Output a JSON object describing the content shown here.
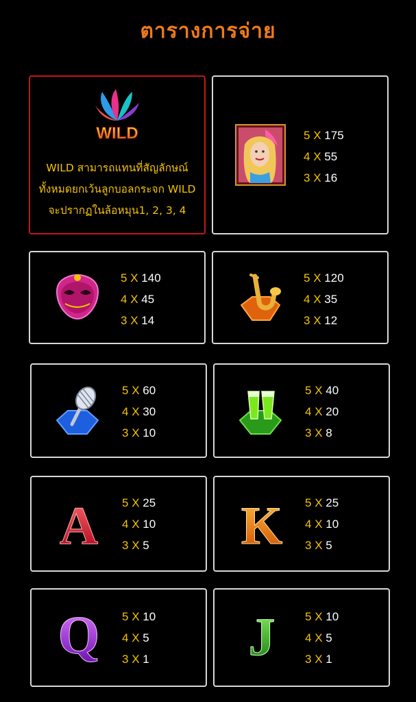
{
  "title": "ตารางการจ่าย",
  "wild": {
    "description": "WILD สามารถแทนที่สัญลักษณ์ทั้งหมดยกเว้นลูกบอลกระจก WILD จะปรากฏในล้อหมุน1, 2, 3, 4",
    "line1": "WILD สามารถแทนที่สัญลักษณ์",
    "line2": "ทั้งหมดยกเว้นลูกบอลกระจก WILD",
    "line3": "จะปรากฏในล้อหมุน1, 2, 3, 4",
    "logo_text": "WILD",
    "icon": "wild-feather-icon"
  },
  "symbols": [
    {
      "id": "woman",
      "icon": "carnival-woman-icon",
      "pays": [
        {
          "count": "5",
          "x": "X",
          "value": "175"
        },
        {
          "count": "4",
          "x": "X",
          "value": "55"
        },
        {
          "count": "3",
          "x": "X",
          "value": "16"
        }
      ]
    },
    {
      "id": "mask",
      "icon": "carnival-mask-icon",
      "pays": [
        {
          "count": "5",
          "x": "X",
          "value": "140"
        },
        {
          "count": "4",
          "x": "X",
          "value": "45"
        },
        {
          "count": "3",
          "x": "X",
          "value": "14"
        }
      ]
    },
    {
      "id": "saxophone",
      "icon": "saxophone-icon",
      "pays": [
        {
          "count": "5",
          "x": "X",
          "value": "120"
        },
        {
          "count": "4",
          "x": "X",
          "value": "35"
        },
        {
          "count": "3",
          "x": "X",
          "value": "12"
        }
      ]
    },
    {
      "id": "microphone",
      "icon": "microphone-icon",
      "pays": [
        {
          "count": "5",
          "x": "X",
          "value": "60"
        },
        {
          "count": "4",
          "x": "X",
          "value": "30"
        },
        {
          "count": "3",
          "x": "X",
          "value": "10"
        }
      ]
    },
    {
      "id": "drinks",
      "icon": "champagne-glasses-icon",
      "pays": [
        {
          "count": "5",
          "x": "X",
          "value": "40"
        },
        {
          "count": "4",
          "x": "X",
          "value": "20"
        },
        {
          "count": "3",
          "x": "X",
          "value": "8"
        }
      ]
    },
    {
      "id": "A",
      "icon": "letter-a-icon",
      "letter": "A",
      "pays": [
        {
          "count": "5",
          "x": "X",
          "value": "25"
        },
        {
          "count": "4",
          "x": "X",
          "value": "10"
        },
        {
          "count": "3",
          "x": "X",
          "value": "5"
        }
      ]
    },
    {
      "id": "K",
      "icon": "letter-k-icon",
      "letter": "K",
      "pays": [
        {
          "count": "5",
          "x": "X",
          "value": "25"
        },
        {
          "count": "4",
          "x": "X",
          "value": "10"
        },
        {
          "count": "3",
          "x": "X",
          "value": "5"
        }
      ]
    },
    {
      "id": "Q",
      "icon": "letter-q-icon",
      "letter": "Q",
      "pays": [
        {
          "count": "5",
          "x": "X",
          "value": "10"
        },
        {
          "count": "4",
          "x": "X",
          "value": "5"
        },
        {
          "count": "3",
          "x": "X",
          "value": "1"
        }
      ]
    },
    {
      "id": "J",
      "icon": "letter-j-icon",
      "letter": "J",
      "pays": [
        {
          "count": "5",
          "x": "X",
          "value": "10"
        },
        {
          "count": "4",
          "x": "X",
          "value": "5"
        },
        {
          "count": "3",
          "x": "X",
          "value": "1"
        }
      ]
    }
  ],
  "colors": {
    "title": "#f07a1a",
    "count": "#f5c200",
    "value": "#ffffff",
    "wild_border": "#c4161c",
    "card_border": "#d8d8d8"
  }
}
